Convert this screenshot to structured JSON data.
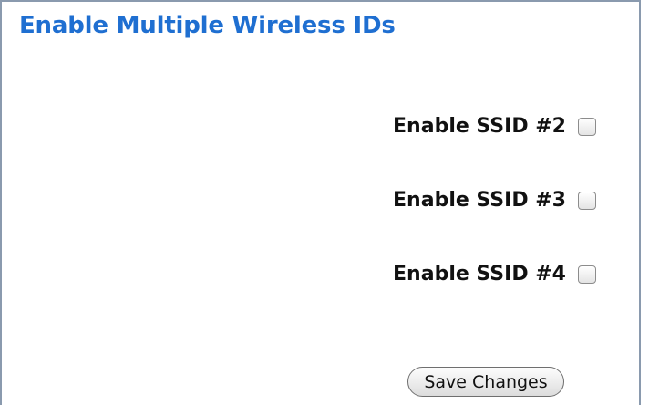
{
  "page": {
    "title": "Enable Multiple Wireless IDs"
  },
  "ssid_options": [
    {
      "label": "Enable SSID #2",
      "checked": false
    },
    {
      "label": "Enable SSID #3",
      "checked": false
    },
    {
      "label": "Enable SSID #4",
      "checked": false
    }
  ],
  "actions": {
    "save_label": "Save Changes"
  },
  "colors": {
    "title": "#1f6fd1",
    "panel_border": "#8a9aae",
    "text": "#111111"
  }
}
